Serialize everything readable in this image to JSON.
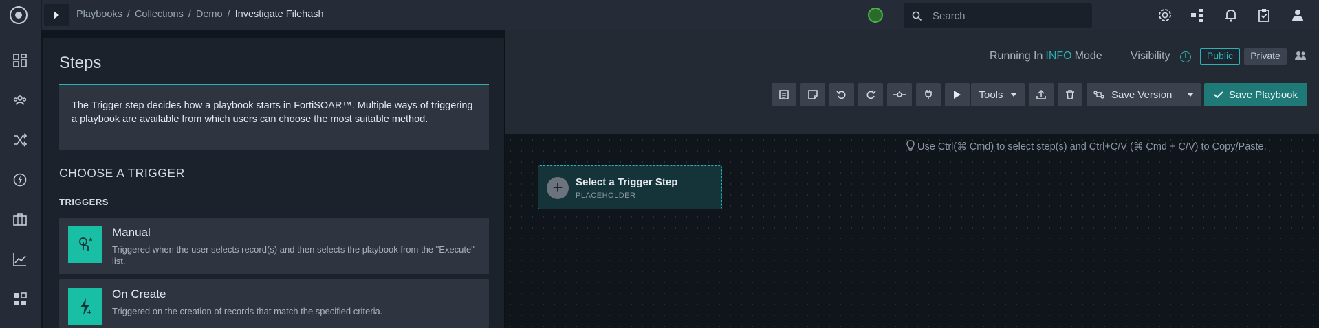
{
  "topbar": {
    "breadcrumbs": [
      "Playbooks",
      "Collections",
      "Demo"
    ],
    "separator": "/",
    "current": "Investigate Filehash",
    "search_placeholder": "Search"
  },
  "header": {
    "running_prefix": "Running In",
    "mode_value": "INFO",
    "mode_suffix": "Mode",
    "visibility_label": "Visibility",
    "public_label": "Public",
    "private_label": "Private",
    "tools_label": "Tools",
    "save_version_label": "Save Version",
    "save_playbook_label": "Save Playbook"
  },
  "canvas": {
    "hint": "Use Ctrl(⌘ Cmd) to select step(s) and Ctrl+C/V (⌘ Cmd + C/V) to Copy/Paste.",
    "placeholder_title": "Select a Trigger Step",
    "placeholder_sub": "PLACEHOLDER"
  },
  "panel": {
    "title": "Steps",
    "intro": "The Trigger step decides how a playbook starts in FortiSOAR™. Multiple ways of triggering a playbook are available from which users can choose the most suitable method.",
    "choose_heading": "CHOOSE A TRIGGER",
    "triggers_label": "TRIGGERS",
    "triggers": [
      {
        "name": "Manual",
        "description": "Triggered when the user selects record(s) and then selects the playbook from the \"Execute\" list."
      },
      {
        "name": "On Create",
        "description": "Triggered on the creation of records that match the specified criteria."
      }
    ]
  },
  "colors": {
    "accent": "#2bb3b3",
    "trigger_icon_bg": "#19bfa4",
    "save_button": "#1f7a77"
  }
}
